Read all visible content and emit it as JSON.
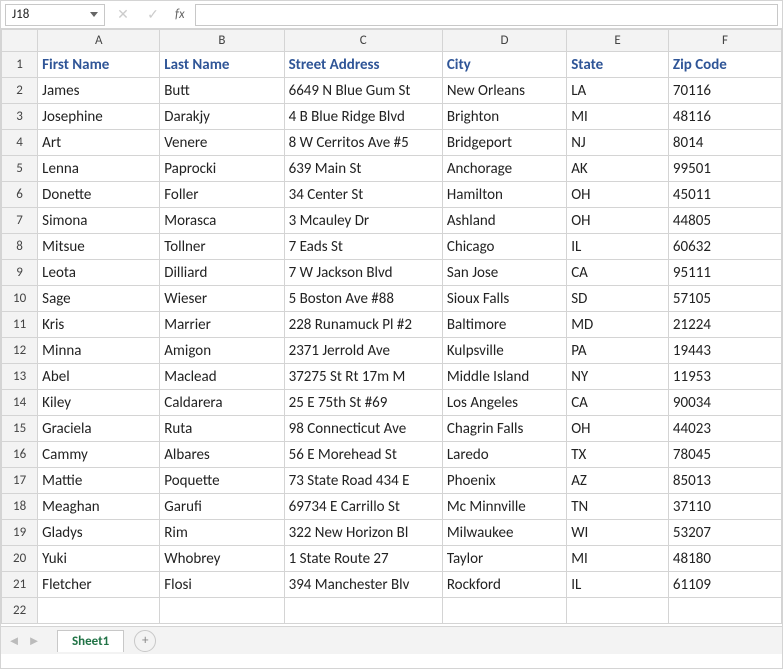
{
  "formula_bar": {
    "name_box_value": "J18",
    "cancel_icon": "✕",
    "confirm_icon": "✓",
    "fx_label": "fx",
    "formula_value": ""
  },
  "columns": [
    "A",
    "B",
    "C",
    "D",
    "E",
    "F"
  ],
  "headers": [
    "First Name",
    "Last Name",
    "Street Address",
    "City",
    "State",
    "Zip Code"
  ],
  "active_row": 18,
  "last_row_label": "22",
  "chart_data": {
    "type": "table",
    "columns": [
      "First Name",
      "Last Name",
      "Street Address",
      "City",
      "State",
      "Zip Code"
    ],
    "rows": [
      [
        "James",
        "Butt",
        "6649 N Blue Gum St",
        "New Orleans",
        "LA",
        "70116"
      ],
      [
        "Josephine",
        "Darakjy",
        "4 B Blue Ridge Blvd",
        "Brighton",
        "MI",
        "48116"
      ],
      [
        "Art",
        "Venere",
        "8 W Cerritos Ave #5",
        "Bridgeport",
        "NJ",
        "8014"
      ],
      [
        "Lenna",
        "Paprocki",
        "639 Main St",
        "Anchorage",
        "AK",
        "99501"
      ],
      [
        "Donette",
        "Foller",
        "34 Center St",
        "Hamilton",
        "OH",
        "45011"
      ],
      [
        "Simona",
        "Morasca",
        "3 Mcauley Dr",
        "Ashland",
        "OH",
        "44805"
      ],
      [
        "Mitsue",
        "Tollner",
        "7 Eads St",
        "Chicago",
        "IL",
        "60632"
      ],
      [
        "Leota",
        "Dilliard",
        "7 W Jackson Blvd",
        "San Jose",
        "CA",
        "95111"
      ],
      [
        "Sage",
        "Wieser",
        "5 Boston Ave #88",
        "Sioux Falls",
        "SD",
        "57105"
      ],
      [
        "Kris",
        "Marrier",
        "228 Runamuck Pl #2",
        "Baltimore",
        "MD",
        "21224"
      ],
      [
        "Minna",
        "Amigon",
        "2371 Jerrold Ave",
        "Kulpsville",
        "PA",
        "19443"
      ],
      [
        "Abel",
        "Maclead",
        "37275 St  Rt 17m M",
        "Middle Island",
        "NY",
        "11953"
      ],
      [
        "Kiley",
        "Caldarera",
        "25 E 75th St #69",
        "Los Angeles",
        "CA",
        "90034"
      ],
      [
        "Graciela",
        "Ruta",
        "98 Connecticut Ave",
        "Chagrin Falls",
        "OH",
        "44023"
      ],
      [
        "Cammy",
        "Albares",
        "56 E Morehead St",
        "Laredo",
        "TX",
        "78045"
      ],
      [
        "Mattie",
        "Poquette",
        "73 State Road 434 E",
        "Phoenix",
        "AZ",
        "85013"
      ],
      [
        "Meaghan",
        "Garufi",
        "69734 E Carrillo St",
        "Mc Minnville",
        "TN",
        "37110"
      ],
      [
        "Gladys",
        "Rim",
        "322 New Horizon Bl",
        "Milwaukee",
        "WI",
        "53207"
      ],
      [
        "Yuki",
        "Whobrey",
        "1 State Route 27",
        "Taylor",
        "MI",
        "48180"
      ],
      [
        "Fletcher",
        "Flosi",
        "394 Manchester Blv",
        "Rockford",
        "IL",
        "61109"
      ]
    ]
  },
  "sheet_bar": {
    "prev_icon": "◄",
    "next_icon": "►",
    "tab_label": "Sheet1",
    "add_icon": "+"
  }
}
